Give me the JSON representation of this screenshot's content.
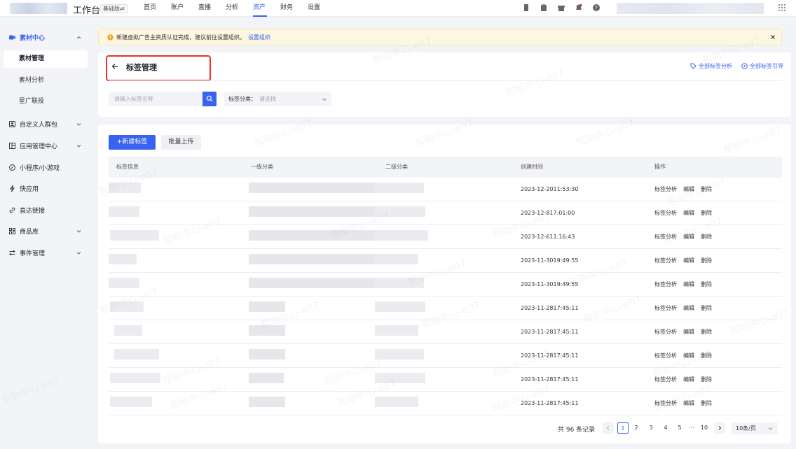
{
  "topbar": {
    "title": "工作台",
    "version_tag": "基础版⇄",
    "nav": [
      "首页",
      "账户",
      "直播",
      "分析",
      "资产",
      "财务",
      "设置"
    ],
    "nav_active_index": 4,
    "icons": [
      "phone-icon",
      "clipboard-icon",
      "gift-icon",
      "bell-icon",
      "help-icon"
    ]
  },
  "sidebar": {
    "groups": [
      {
        "label": "素材中心",
        "icon": "video-icon",
        "expanded": true,
        "children": [
          "素材管理",
          "素材分析",
          "星广联投"
        ],
        "active_child": 0
      },
      {
        "label": "自定义人群包",
        "icon": "crowd-icon",
        "expanded": false
      },
      {
        "label": "应用管理中心",
        "icon": "app-icon",
        "expanded": false
      },
      {
        "label": "小程序/小游戏",
        "icon": "miniapp-icon",
        "expanded": false
      },
      {
        "label": "快应用",
        "icon": "lightning-icon",
        "expanded": false
      },
      {
        "label": "直达链接",
        "icon": "link-icon",
        "expanded": false
      },
      {
        "label": "商品库",
        "icon": "grid-icon",
        "expanded": false
      },
      {
        "label": "事件管理",
        "icon": "event-icon",
        "expanded": false
      }
    ]
  },
  "notice": {
    "text": "新建虚拟广告主资质认证完成，建议前往设置组织。",
    "link": "设置组织"
  },
  "header": {
    "title": "标签管理",
    "links": [
      "全部标签分析",
      "全部标签引导"
    ]
  },
  "filters": {
    "search_placeholder": "请输入标签名称",
    "category_label": "标签分类：",
    "category_placeholder": "请选择"
  },
  "toolbar": {
    "new_label": "+新建标签",
    "batch_upload": "批量上传"
  },
  "table": {
    "columns": [
      "标签信息",
      "一级分类",
      "二级分类",
      "创建时间",
      "操作"
    ],
    "row_actions": [
      "标签分析",
      "编辑",
      "删除"
    ],
    "rows": [
      {
        "created": "2023-12-2011:53:30"
      },
      {
        "created": "2023-12-817:01:00"
      },
      {
        "created": "2023-12-611:16:43"
      },
      {
        "created": "2023-11-3019:49:55"
      },
      {
        "created": "2023-11-3019:49:55"
      },
      {
        "created": "2023-11-2817:45:11"
      },
      {
        "created": "2023-11-2817:45:11"
      },
      {
        "created": "2023-11-2817:45:11"
      },
      {
        "created": "2023-11-2817:45:11"
      },
      {
        "created": "2023-11-2817:45:11"
      }
    ]
  },
  "pagination": {
    "total_text": "共 96 条记录",
    "pages": [
      "1",
      "2",
      "3",
      "4",
      "5",
      "···",
      "10"
    ],
    "current": "1",
    "page_size": "10条/页"
  },
  "watermark": "帮助中心-e07",
  "colors": {
    "accent": "#3a62f0",
    "highlight_box": "#e8322b",
    "notice_bg": "#fdf6e0"
  }
}
